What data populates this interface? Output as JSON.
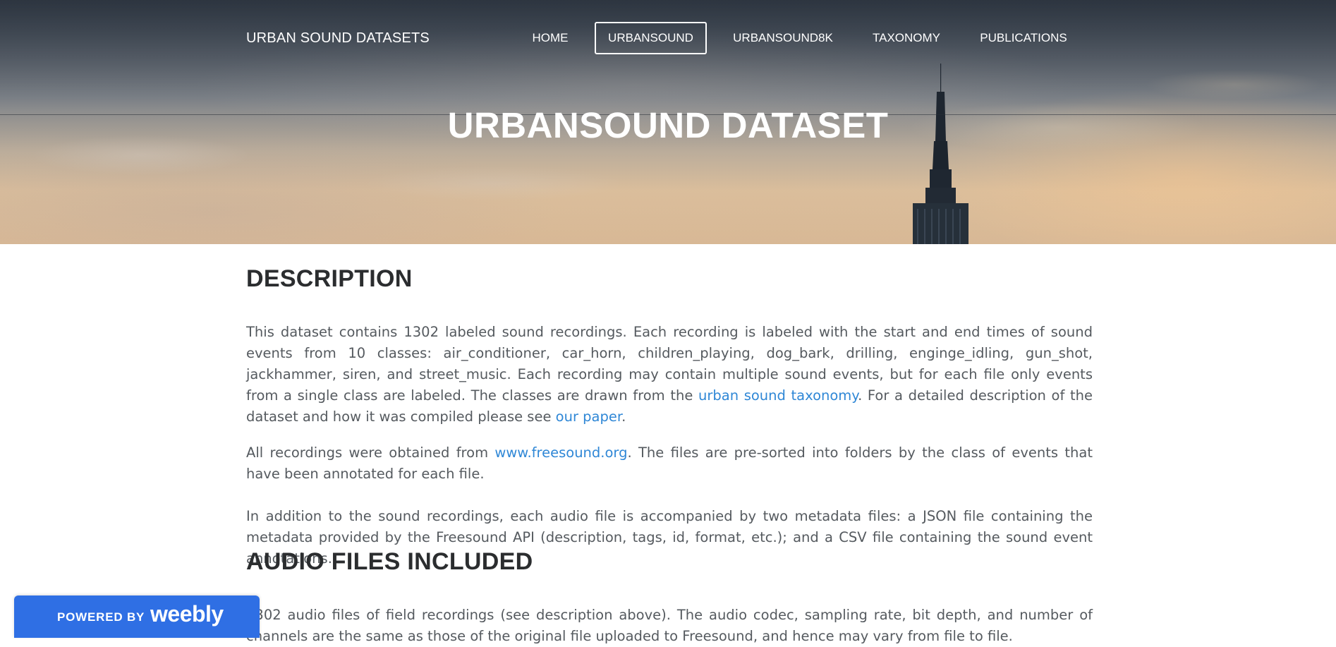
{
  "header": {
    "site_title": "URBAN SOUND DATASETS",
    "nav": [
      {
        "label": "HOME",
        "active": false
      },
      {
        "label": "URBANSOUND",
        "active": true
      },
      {
        "label": "URBANSOUND8K",
        "active": false
      },
      {
        "label": "TAXONOMY",
        "active": false
      },
      {
        "label": "PUBLICATIONS",
        "active": false
      }
    ],
    "hero_title": "URBANSOUND DATASET"
  },
  "description": {
    "heading": "DESCRIPTION",
    "p1_part1": "This dataset contains 1302 labeled sound recordings. Each recording is labeled with the start and end times of sound events from 10 classes: air_conditioner, car_horn, children_playing, dog_bark, drilling, enginge_idling, gun_shot, jackhammer, siren, and street_music. Each recording may contain multiple sound events, but for each file only events from a single class are labeled. The classes are drawn from the ",
    "p1_link1": "urban sound taxonomy",
    "p1_part2": ". For a detailed description of the dataset and how it was compiled please see ",
    "p1_link2": "our paper",
    "p1_part3": ".",
    "p2_part1": "All recordings were obtained from ",
    "p2_link": "www.freesound.org",
    "p2_part2": ". The files are pre-sorted into folders by the class of events that have been annotated for each file.",
    "p3": "In addition to the sound recordings, each audio file is accompanied by two metadata files: a JSON file containing the metadata provided by the Freesound API (description, tags, id, format, etc.); and a CSV file containing the sound event annotations."
  },
  "audio_files": {
    "heading": "AUDIO FILES INCLUDED",
    "p1": "1302 audio files of field recordings (see description above). The audio codec, sampling rate, bit depth, and number of channels are the same as those of the original file uploaded to Freesound, and hence may vary from file to file."
  },
  "badge": {
    "powered_by": "POWERED BY",
    "logo": "weebly",
    "color": "#2f6fe4"
  },
  "colors": {
    "link": "#2f87d6",
    "heading": "#2b2d2f",
    "body_text": "#555a5f"
  }
}
